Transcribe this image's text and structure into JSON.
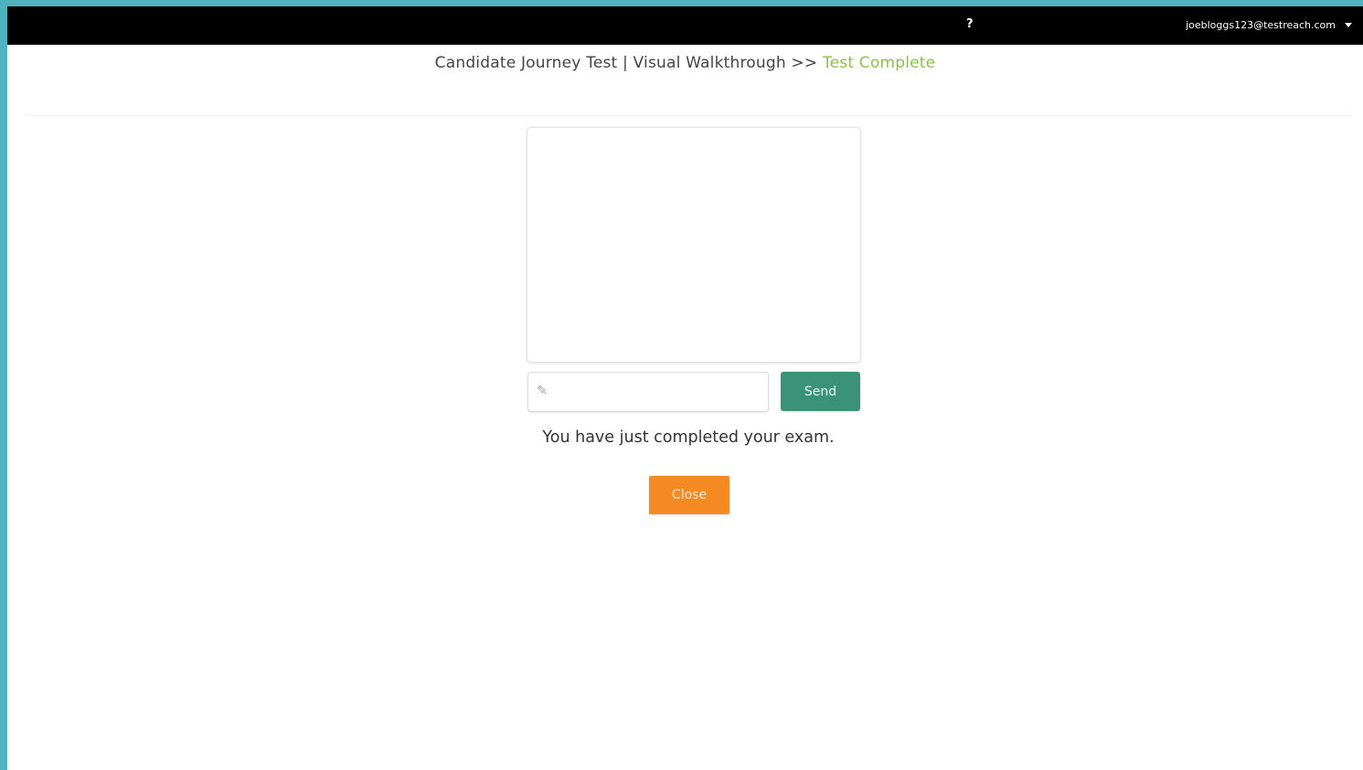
{
  "header": {
    "help_label": "?",
    "user_email": "joebloggs123@testreach.com"
  },
  "breadcrumb": {
    "path": "Candidate Journey Test | Visual Walkthrough >>",
    "current": "Test Complete"
  },
  "chat": {
    "input_value": "",
    "send_label": "Send"
  },
  "main": {
    "completed_message": "You have just completed your exam.",
    "close_label": "Close"
  },
  "colors": {
    "frame_border": "#4fb3bf",
    "topbar": "#000000",
    "breadcrumb_current": "#8cc04b",
    "send_button": "#3a9279",
    "close_button": "#f58a22"
  },
  "icons": {
    "input_icon": "pencil-icon",
    "user_menu_icon": "caret-down-icon"
  }
}
